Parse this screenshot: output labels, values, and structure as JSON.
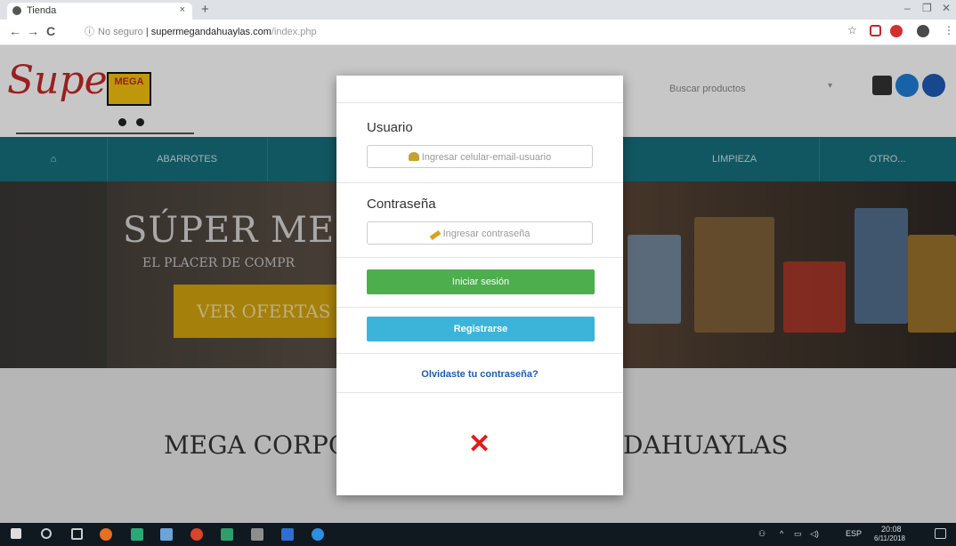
{
  "browser": {
    "tab_title": "Tienda",
    "tab_close": "×",
    "new_tab": "+",
    "back": "←",
    "forward": "→",
    "reload": "C",
    "security_label": "No seguro",
    "url_host": "supermegandahuaylas.com",
    "url_path": "/index.php"
  },
  "site": {
    "logo_text": "Super",
    "logo_badge": "MEGA",
    "search_placeholder": "Buscar productos",
    "nav": [
      "",
      "Abarrotes",
      "",
      "",
      "Limpieza",
      "Otro..."
    ],
    "hero_title": "SÚPER ME",
    "hero_subtitle": "EL PLACER DE COMPR",
    "hero_button": "VER OFERTAS",
    "corp_left": "MEGA CORPO",
    "corp_right": "DAHUAYLAS"
  },
  "modal": {
    "user_label": "Usuario",
    "user_placeholder": "Ingresar celular-email-usuario",
    "password_label": "Contraseña",
    "password_placeholder": "Ingresar contraseña",
    "login_button": "Iniciar sesión",
    "register_button": "Registrarse",
    "forgot_link": "Olvidaste tu contraseña?",
    "close_symbol": "✕"
  },
  "taskbar": {
    "lang": "ESP",
    "time": "20:08",
    "date": "6/11/2018"
  },
  "colors": {
    "login_green": "#4cae4c",
    "register_blue": "#3cb4da",
    "nav_teal": "#16707d",
    "close_red": "#e31b1b"
  }
}
